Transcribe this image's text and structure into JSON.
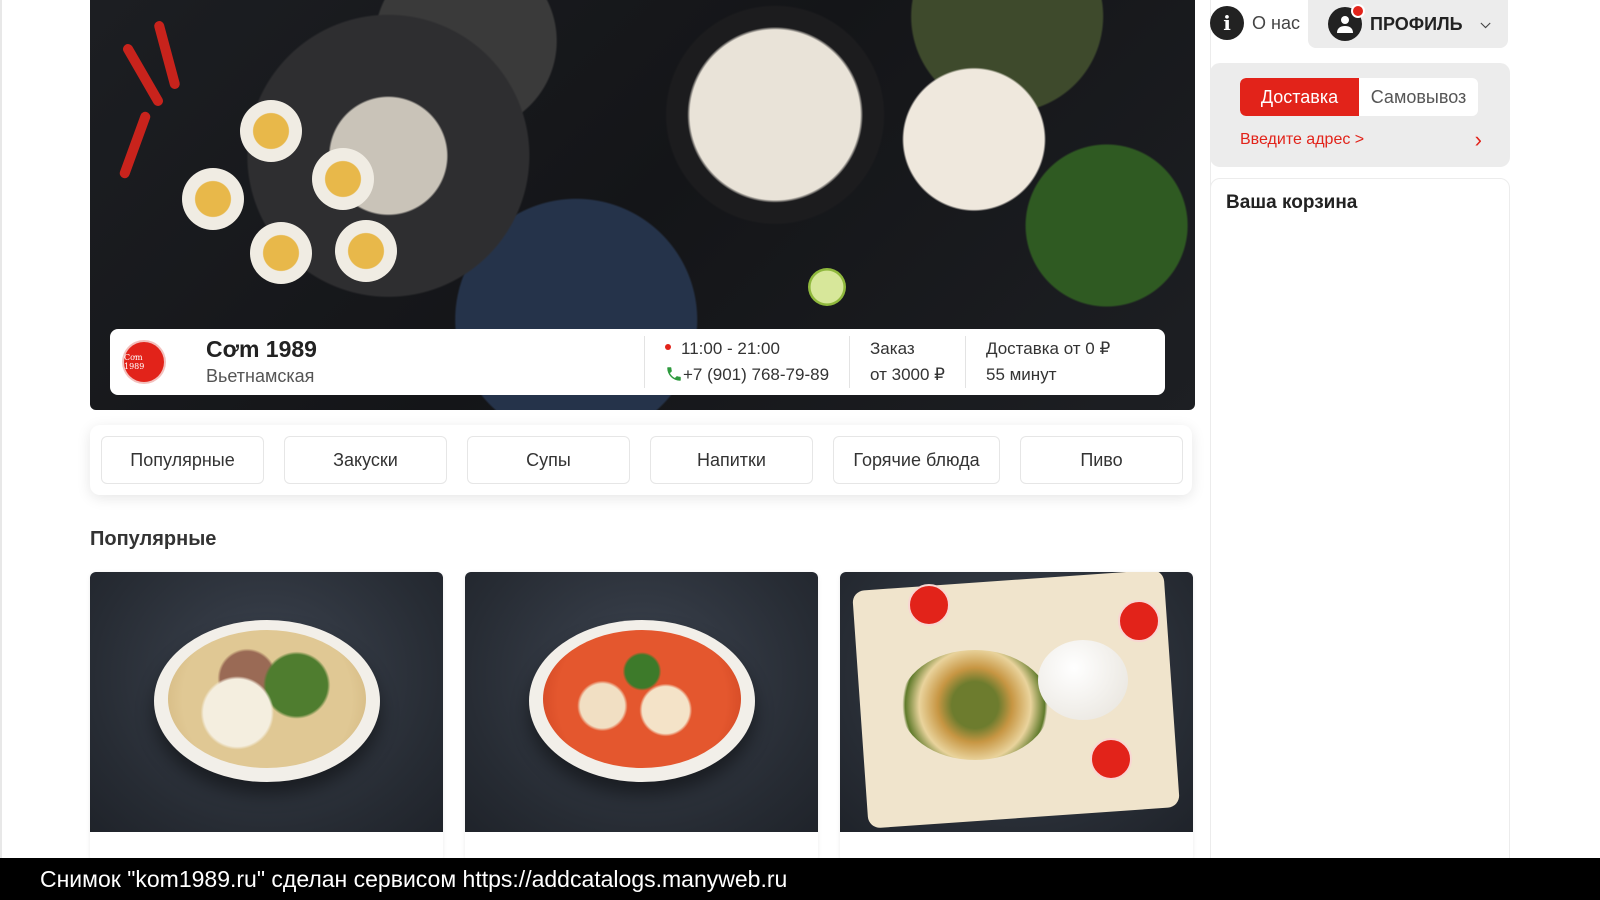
{
  "header": {
    "about_label": "О нас",
    "profile_label": "ПРОФИЛЬ"
  },
  "restaurant": {
    "name": "Cơm 1989",
    "cuisine": "Вьетнамская",
    "hours": "11:00 - 21:00",
    "phone": "+7 (901) 768-79-89",
    "order_label": "Заказ",
    "order_min": "от 3000 ₽",
    "delivery_label": "Доставка от 0 ₽",
    "delivery_time": "55 минут",
    "logo_text": "Cơm 1989"
  },
  "categories": [
    {
      "label": "Популярные"
    },
    {
      "label": "Закуски"
    },
    {
      "label": "Супы"
    },
    {
      "label": "Напитки"
    },
    {
      "label": "Горячие блюда"
    },
    {
      "label": "Пиво"
    }
  ],
  "section_title": "Популярные",
  "delivery": {
    "option_delivery": "Доставка",
    "option_pickup": "Самовывоз",
    "address_prompt": "Введите адрес >"
  },
  "cart": {
    "title": "Ваша корзина"
  },
  "footer": {
    "caption": "Снимок \"kom1989.ru\" сделан сервисом https://addcatalogs.manyweb.ru"
  },
  "colors": {
    "accent": "#e2231a",
    "panel": "#ececec"
  }
}
